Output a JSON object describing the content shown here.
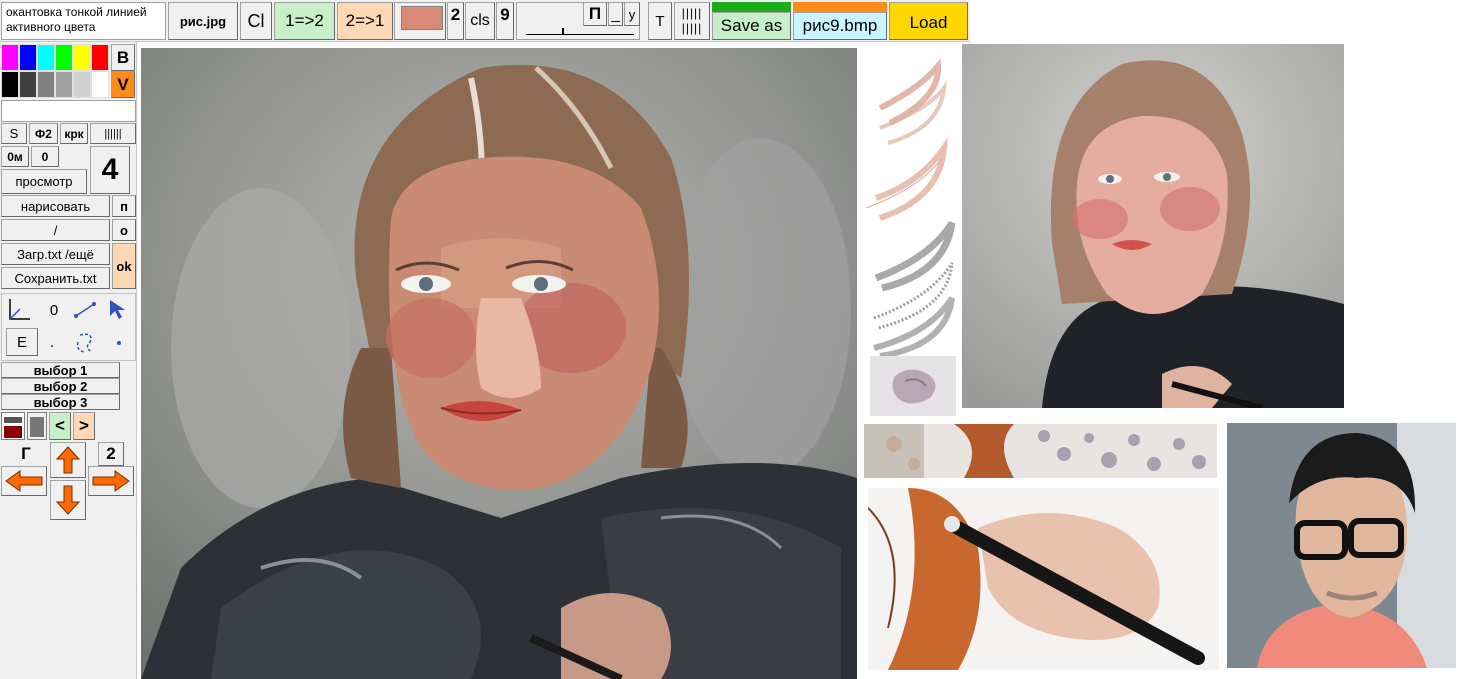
{
  "toolbar": {
    "mode_text": "окантовка тонкой линией активного цвета",
    "file_label": "рис.jpg",
    "cl_label": "Cl",
    "swap12_label": "1=>2",
    "swap21_label": "2=>1",
    "active_color": "#d98a76",
    "num2_label": "2",
    "cls_label": "cls",
    "num9_label": "9",
    "p_label": "П",
    "underscore_label": "_",
    "y_label": "у",
    "t_label": "T",
    "bars_label": "||||| |||||",
    "save_as_label": "Save as",
    "save_file_label": "рис9.bmp",
    "load_label": "Load"
  },
  "palette": {
    "row1": [
      "#ff00ff",
      "#0000ff",
      "#00ffff",
      "#00ff00",
      "#ffff00",
      "#ff0000"
    ],
    "row2": [
      "#000000",
      "#404040",
      "#808080",
      "#a0a0a0",
      "#d0d0d0",
      "#ffffff"
    ],
    "b_label": "B",
    "v_label": "V"
  },
  "left": {
    "s_label": "S",
    "f2_label": "Ф2",
    "krk_label": "крк",
    "bars_label": "||||||",
    "om_label": "0м",
    "zero_label": "0",
    "big_number": "4",
    "preview_label": "просмотр",
    "draw_label": "нарисовать",
    "p_label": "п",
    "slash_label": "/",
    "o_label": "о",
    "load_txt_label": "Загр.txt /ещё",
    "ok_label": "ok",
    "save_txt_label": "Сохранить.txt",
    "tool_zero": "0",
    "e_label": "E",
    "dot_label": ".",
    "choice1": "выбор 1",
    "choice2": "выбор 2",
    "choice3": "выбор 3",
    "lt_label": "<",
    "gt_label": ">",
    "g_label": "Г",
    "num2_label": "2"
  },
  "colors": {
    "green_btn": "#c8f0c8",
    "peach_btn": "#fcd9b4",
    "orange_btn": "#ff8c1a",
    "yellow_btn": "#ffd700",
    "cyan_btn": "#c8f5ff",
    "arrow": "#ff6a00"
  }
}
